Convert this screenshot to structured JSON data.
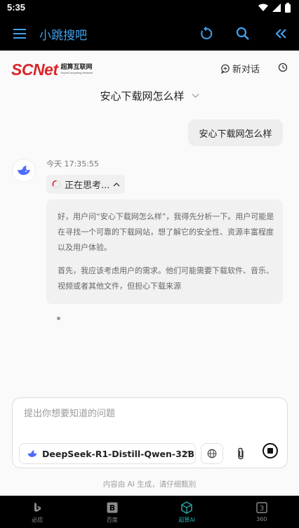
{
  "status_bar": {
    "time": "5:35"
  },
  "app_bar": {
    "title": "小跳搜吧"
  },
  "brand": {
    "logo_text": "SCNet",
    "logo_cn": "超算互联网",
    "logo_en": "SuperComputing Network"
  },
  "header": {
    "new_chat_label": "新对话"
  },
  "conversation": {
    "title": "安心下载网怎么样",
    "user_message": "安心下载网怎么样",
    "bot_time": "今天 17:35:55",
    "thinking_label": "正在思考...",
    "thought_paragraphs": [
      "好，用户问“安心下载网怎么样”，我得先分析一下。用户可能是在寻找一个可靠的下载网站，想了解它的安全性、资源丰富程度以及用户体验。",
      "首先，我应该考虑用户的需求。他们可能需要下载软件、音乐、视频或者其他文件，但担心下载来源"
    ]
  },
  "composer": {
    "placeholder": "提出你想要知道的问题",
    "model_name": "DeepSeek-R1-Distill-Qwen-32B"
  },
  "disclaimer": "内容由 AI 生成，请仔细甄别",
  "bottom_nav": {
    "items": [
      {
        "label": "必应",
        "icon": "bing-icon"
      },
      {
        "label": "百度",
        "icon": "baidu-icon"
      },
      {
        "label": "超算AI",
        "icon": "scnet-ai-icon"
      },
      {
        "label": "360",
        "icon": "360-icon"
      }
    ],
    "active_index": 2
  },
  "colors": {
    "accent": "#3fa2ef",
    "brand_red": "#d9252a",
    "active_nav": "#2aa3a8"
  }
}
